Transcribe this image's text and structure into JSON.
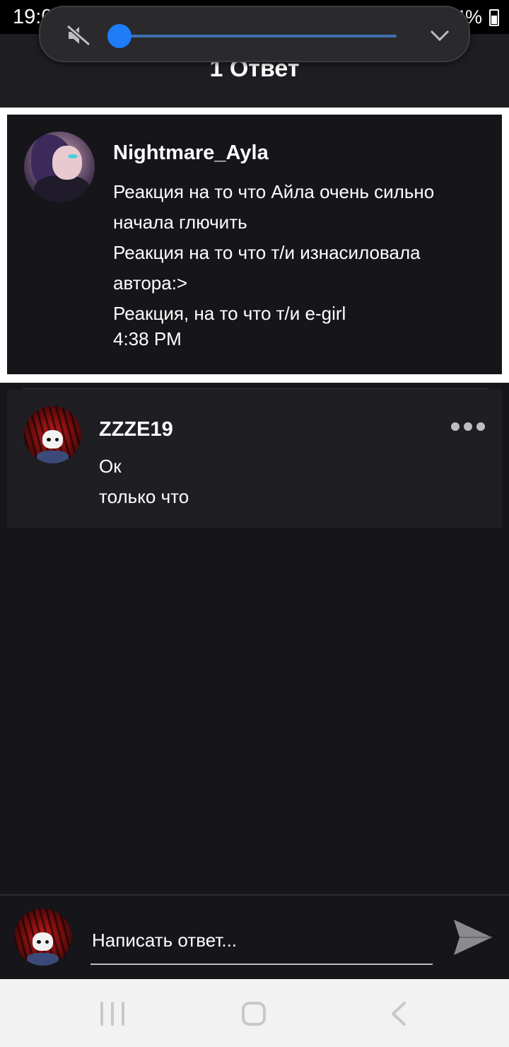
{
  "status_bar": {
    "time": "19:05",
    "battery": "64%"
  },
  "volume_panel": {
    "level_fraction": 0.04,
    "mute_icon": "speaker-muted-icon",
    "expand_icon": "chevron-down-icon"
  },
  "header": {
    "title": "1 Ответ"
  },
  "post": {
    "author": "Nightmare_Ayla",
    "lines": [
      "Реакция на то что Айла очень сильно",
      "начала глючить",
      "Реакция на то что т/и изнасиловала",
      "автора:>",
      "Реакция, на то что т/и e-girl"
    ],
    "time": "4:38 PM"
  },
  "reply": {
    "author": "ZZZE19",
    "text": "Ок",
    "time": "только что",
    "more_icon": "more-horizontal-icon"
  },
  "composer": {
    "placeholder": "Написать ответ...",
    "send_icon": "send-icon"
  },
  "colors": {
    "background": "#161519",
    "header": "#1e1d21",
    "accent": "#1e7cf7",
    "nav_bar": "#f2f2f2"
  }
}
